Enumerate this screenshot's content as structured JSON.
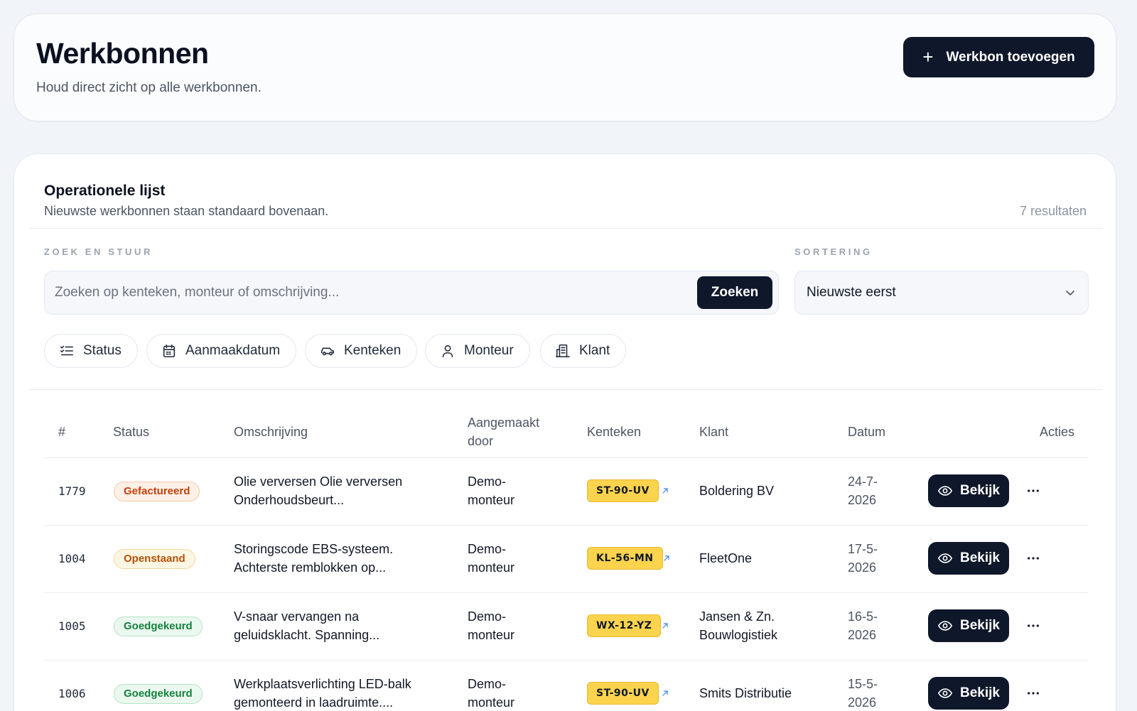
{
  "header": {
    "title": "Werkbonnen",
    "subtitle": "Houd direct zicht op alle werkbonnen.",
    "add_button": "Werkbon toevoegen",
    "add_icon": "plus-icon"
  },
  "list": {
    "title": "Operationele lijst",
    "subtitle": "Nieuwste werkbonnen staan standaard bovenaan.",
    "result_count": "7 resultaten"
  },
  "search": {
    "label": "ZOEK EN STUUR",
    "placeholder": "Zoeken op kenteken, monteur of omschrijving...",
    "value": "",
    "button": "Zoeken"
  },
  "sort": {
    "label": "SORTERING",
    "value": "Nieuwste eerst",
    "icon": "chevron-down-icon"
  },
  "filters": [
    {
      "label": "Status",
      "icon": "checklist-icon"
    },
    {
      "label": "Aanmaakdatum",
      "icon": "calendar-icon"
    },
    {
      "label": "Kenteken",
      "icon": "car-icon"
    },
    {
      "label": "Monteur",
      "icon": "user-icon"
    },
    {
      "label": "Klant",
      "icon": "building-icon"
    }
  ],
  "table": {
    "columns": {
      "number": "#",
      "status": "Status",
      "description": "Omschrijving",
      "created_by_line1": "Aangemaakt",
      "created_by_line2": "door",
      "plate": "Kenteken",
      "customer": "Klant",
      "date": "Datum",
      "actions": "Acties"
    },
    "rows": [
      {
        "number": "1779",
        "status": "Gefactureerd",
        "status_color": "#c2410c",
        "desc1": "Olie verversen Olie verversen",
        "desc2": "Onderhoudsbeurt...",
        "by1": "Demo-",
        "by2": "monteur",
        "plate": "ST-90-UV",
        "cust1": "Boldering BV",
        "cust2": "",
        "date1": "24-7-",
        "date2": "2026",
        "view": "Bekijk"
      },
      {
        "number": "1004",
        "status": "Openstaand",
        "status_color": "#b45309",
        "desc1": "Storingscode EBS-systeem.",
        "desc2": "Achterste remblokken op...",
        "by1": "Demo-",
        "by2": "monteur",
        "plate": "KL-56-MN",
        "cust1": "FleetOne",
        "cust2": "",
        "date1": "17-5-",
        "date2": "2026",
        "view": "Bekijk"
      },
      {
        "number": "1005",
        "status": "Goedgekeurd",
        "status_color": "#15803d",
        "desc1": "V-snaar vervangen na",
        "desc2": "geluidsklacht. Spanning...",
        "by1": "Demo-",
        "by2": "monteur",
        "plate": "WX-12-YZ",
        "cust1": "Jansen & Zn.",
        "cust2": "Bouwlogistiek",
        "date1": "16-5-",
        "date2": "2026",
        "view": "Bekijk"
      },
      {
        "number": "1006",
        "status": "Goedgekeurd",
        "status_color": "#15803d",
        "desc1": "Werkplaatsverlichting LED-balk",
        "desc2": "gemonteerd in laadruimte....",
        "by1": "Demo-",
        "by2": "monteur",
        "plate": "ST-90-UV",
        "cust1": "Smits Distributie",
        "cust2": "",
        "date1": "15-5-",
        "date2": "2026",
        "view": "Bekijk"
      }
    ]
  },
  "colors": {
    "primary": "#0f172a",
    "background": "#f1f4f8",
    "plate": "#fcd34d"
  }
}
